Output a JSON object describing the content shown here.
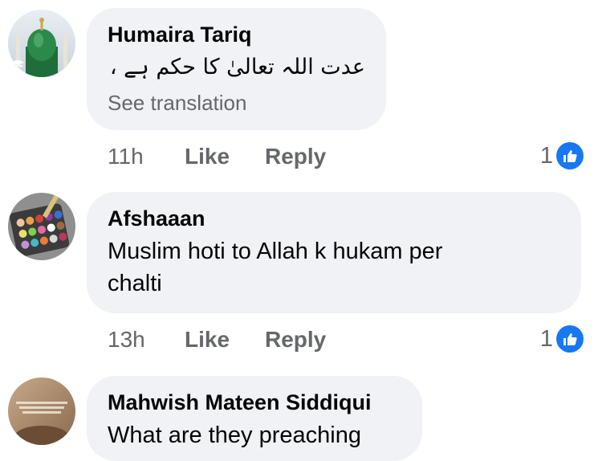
{
  "comments": [
    {
      "author": "Humaira Tariq",
      "text": "عدت اللہ تعالیٰ کا حکم ہے ،",
      "see_translation": "See translation",
      "time": "11h",
      "like_label": "Like",
      "reply_label": "Reply",
      "reaction_count": "1"
    },
    {
      "author": "Afshaaan",
      "text_line1": "Muslim hoti to Allah k hukam per",
      "text_line2": "chalti",
      "time": "13h",
      "like_label": "Like",
      "reply_label": "Reply",
      "reaction_count": "1"
    },
    {
      "author": "Mahwish Mateen Siddiqui",
      "text": "What are they preaching"
    }
  ],
  "colors": {
    "bubble_bg": "#f0f2f5",
    "meta_text": "#65676b",
    "like_blue": "#1877f2"
  },
  "icons": [
    "like-reaction-icon",
    "avatar-mosque",
    "avatar-makeup-palette",
    "avatar-text-photo"
  ]
}
